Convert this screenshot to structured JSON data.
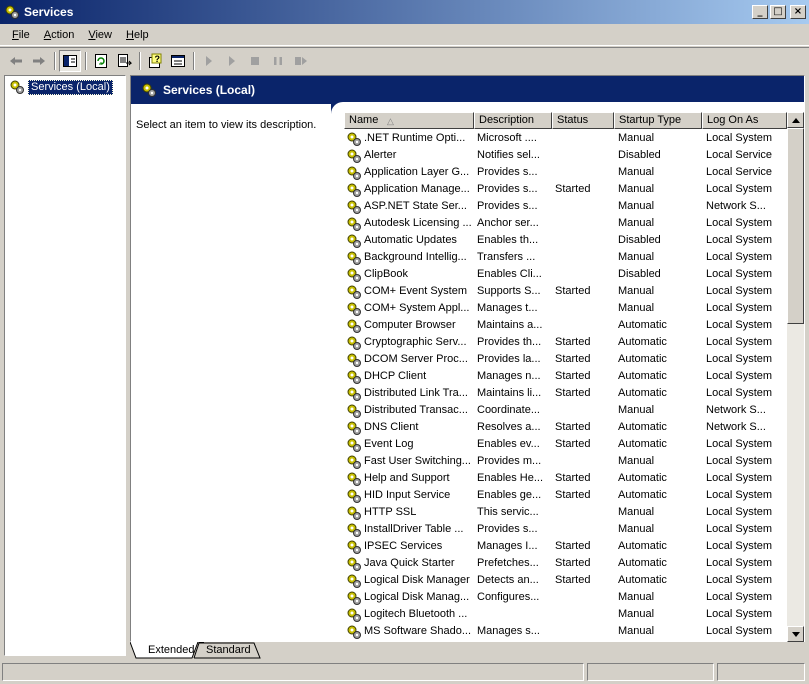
{
  "window": {
    "title": "Services"
  },
  "menu": [
    {
      "u": "F",
      "rest": "ile"
    },
    {
      "u": "A",
      "rest": "ction"
    },
    {
      "u": "V",
      "rest": "iew"
    },
    {
      "u": "H",
      "rest": "elp"
    }
  ],
  "tree": {
    "root_label": "Services (Local)"
  },
  "pane": {
    "header_title": "Services (Local)",
    "description_prompt": "Select an item to view its description."
  },
  "columns": [
    "Name",
    "Description",
    "Status",
    "Startup Type",
    "Log On As"
  ],
  "sort": {
    "column": "Name",
    "direction": "ascending"
  },
  "services": [
    {
      "name": ".NET Runtime Opti...",
      "description": "Microsoft ....",
      "status": "",
      "startup": "Manual",
      "logon": "Local System"
    },
    {
      "name": "Alerter",
      "description": "Notifies sel...",
      "status": "",
      "startup": "Disabled",
      "logon": "Local Service"
    },
    {
      "name": "Application Layer G...",
      "description": "Provides s...",
      "status": "",
      "startup": "Manual",
      "logon": "Local Service"
    },
    {
      "name": "Application Manage...",
      "description": "Provides s...",
      "status": "Started",
      "startup": "Manual",
      "logon": "Local System"
    },
    {
      "name": "ASP.NET State Ser...",
      "description": "Provides s...",
      "status": "",
      "startup": "Manual",
      "logon": "Network S..."
    },
    {
      "name": "Autodesk Licensing ...",
      "description": "Anchor ser...",
      "status": "",
      "startup": "Manual",
      "logon": "Local System"
    },
    {
      "name": "Automatic Updates",
      "description": "Enables th...",
      "status": "",
      "startup": "Disabled",
      "logon": "Local System"
    },
    {
      "name": "Background Intellig...",
      "description": "Transfers ...",
      "status": "",
      "startup": "Manual",
      "logon": "Local System"
    },
    {
      "name": "ClipBook",
      "description": "Enables Cli...",
      "status": "",
      "startup": "Disabled",
      "logon": "Local System"
    },
    {
      "name": "COM+ Event System",
      "description": "Supports S...",
      "status": "Started",
      "startup": "Manual",
      "logon": "Local System"
    },
    {
      "name": "COM+ System Appl...",
      "description": "Manages t...",
      "status": "",
      "startup": "Manual",
      "logon": "Local System"
    },
    {
      "name": "Computer Browser",
      "description": "Maintains a...",
      "status": "",
      "startup": "Automatic",
      "logon": "Local System"
    },
    {
      "name": "Cryptographic Serv...",
      "description": "Provides th...",
      "status": "Started",
      "startup": "Automatic",
      "logon": "Local System"
    },
    {
      "name": "DCOM Server Proc...",
      "description": "Provides la...",
      "status": "Started",
      "startup": "Automatic",
      "logon": "Local System"
    },
    {
      "name": "DHCP Client",
      "description": "Manages n...",
      "status": "Started",
      "startup": "Automatic",
      "logon": "Local System"
    },
    {
      "name": "Distributed Link Tra...",
      "description": "Maintains li...",
      "status": "Started",
      "startup": "Automatic",
      "logon": "Local System"
    },
    {
      "name": "Distributed Transac...",
      "description": "Coordinate...",
      "status": "",
      "startup": "Manual",
      "logon": "Network S..."
    },
    {
      "name": "DNS Client",
      "description": "Resolves a...",
      "status": "Started",
      "startup": "Automatic",
      "logon": "Network S..."
    },
    {
      "name": "Event Log",
      "description": "Enables ev...",
      "status": "Started",
      "startup": "Automatic",
      "logon": "Local System"
    },
    {
      "name": "Fast User Switching...",
      "description": "Provides m...",
      "status": "",
      "startup": "Manual",
      "logon": "Local System"
    },
    {
      "name": "Help and Support",
      "description": "Enables He...",
      "status": "Started",
      "startup": "Automatic",
      "logon": "Local System"
    },
    {
      "name": "HID Input Service",
      "description": "Enables ge...",
      "status": "Started",
      "startup": "Automatic",
      "logon": "Local System"
    },
    {
      "name": "HTTP SSL",
      "description": "This servic...",
      "status": "",
      "startup": "Manual",
      "logon": "Local System"
    },
    {
      "name": "InstallDriver Table ...",
      "description": "Provides s...",
      "status": "",
      "startup": "Manual",
      "logon": "Local System"
    },
    {
      "name": "IPSEC Services",
      "description": "Manages I...",
      "status": "Started",
      "startup": "Automatic",
      "logon": "Local System"
    },
    {
      "name": "Java Quick Starter",
      "description": "Prefetches...",
      "status": "Started",
      "startup": "Automatic",
      "logon": "Local System"
    },
    {
      "name": "Logical Disk Manager",
      "description": "Detects an...",
      "status": "Started",
      "startup": "Automatic",
      "logon": "Local System"
    },
    {
      "name": "Logical Disk Manag...",
      "description": "Configures...",
      "status": "",
      "startup": "Manual",
      "logon": "Local System"
    },
    {
      "name": "Logitech Bluetooth ...",
      "description": "",
      "status": "",
      "startup": "Manual",
      "logon": "Local System"
    },
    {
      "name": "MS Software Shado...",
      "description": "Manages s...",
      "status": "",
      "startup": "Manual",
      "logon": "Local System"
    }
  ],
  "tabs": {
    "extended": "Extended",
    "standard": "Standard",
    "active": "Extended"
  },
  "window_buttons": {
    "minimize": "_",
    "maximize": "□",
    "close": "×"
  },
  "colors": {
    "title_gradient_start": "#0a246a",
    "title_gradient_end": "#a6caf0",
    "header_band": "#0a246a",
    "face": "#d4d0c8"
  },
  "toolbar_icons": [
    "back-arrow-icon",
    "forward-arrow-icon",
    "show-hide-tree-icon",
    "refresh-icon",
    "export-list-icon",
    "help-icon",
    "properties-icon",
    "start-service-icon",
    "start-service-alt-icon",
    "stop-service-icon",
    "pause-service-icon",
    "restart-service-icon"
  ]
}
